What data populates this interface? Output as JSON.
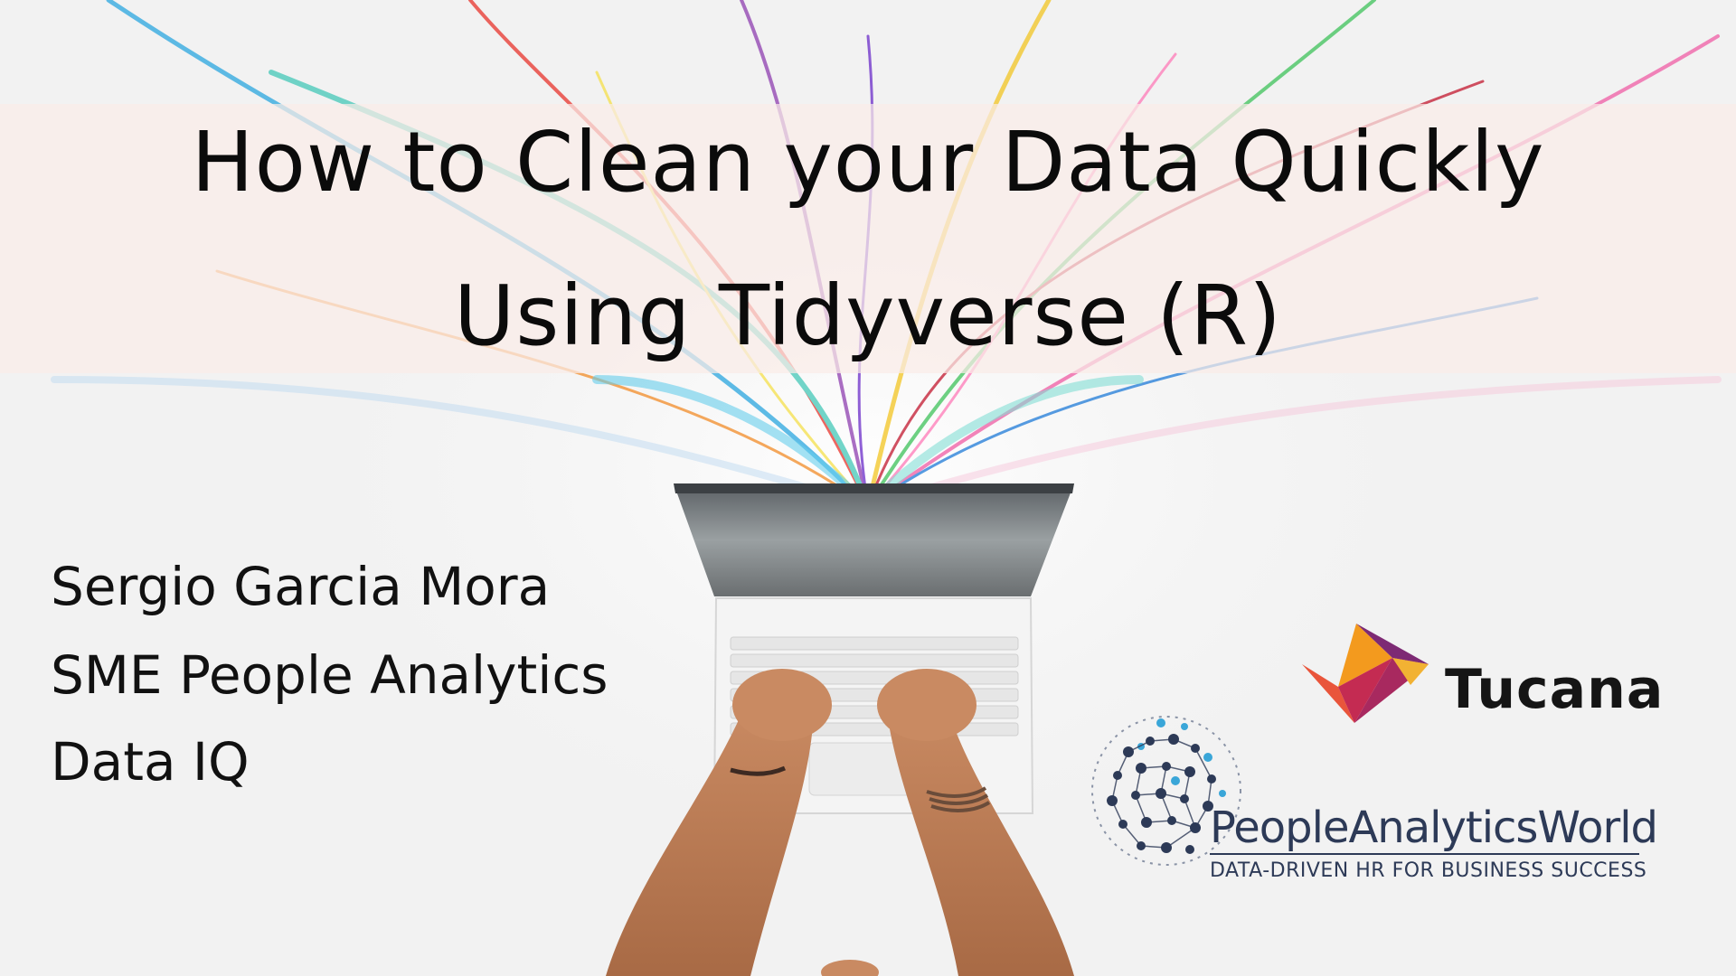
{
  "slide": {
    "title_line_1": "How to Clean your Data Quickly",
    "title_line_2": "Using Tidyverse (R)",
    "presenter": {
      "name": "Sergio Garcia Mora",
      "role": "SME People Analytics",
      "company": "Data IQ"
    }
  },
  "logos": {
    "tucana": {
      "label": "Tucana",
      "colors": [
        "#f39a1e",
        "#e9553b",
        "#c42b52",
        "#7d2a74"
      ]
    },
    "people_analytics_world": {
      "name": "PeopleAnalyticsWorld",
      "tagline": "DATA-DRIVEN HR FOR BUSINESS SUCCESS",
      "colors": [
        "#2d3a57",
        "#3aa6d8"
      ]
    }
  },
  "background": {
    "image": "hands-typing-on-laptop-with-colorful-paint-splash"
  }
}
